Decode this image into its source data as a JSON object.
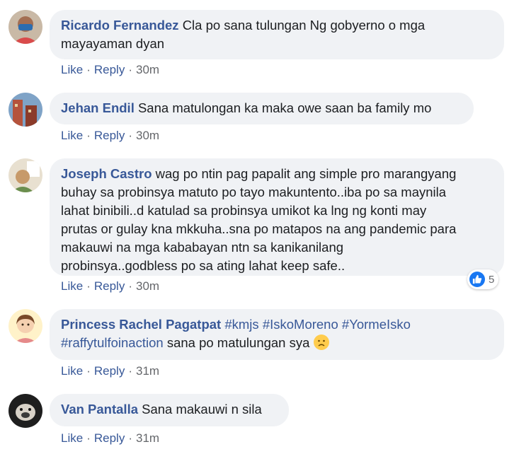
{
  "actions": {
    "like": "Like",
    "reply": "Reply",
    "separator": "·"
  },
  "comments": [
    {
      "author": "Ricardo Fernandez",
      "lines": [
        "Cla po sana tulungan Ng gobyerno o mga",
        "mayayaman dyan"
      ],
      "time": "30m"
    },
    {
      "author": "Jehan Endil",
      "lines": [
        "Sana matulongan ka maka owe saan ba family mo"
      ],
      "time": "30m"
    },
    {
      "author": "Joseph Castro",
      "lines": [
        "wag po ntin pag papalit ang simple pro marangyang",
        "buhay sa probinsya matuto po tayo makuntento..iba po sa maynila",
        "lahat binibili..d katulad sa probinsya umikot ka lng ng konti may",
        "prutas or gulay kna mkkuha..sna po matapos na ang pandemic para",
        "makauwi na mga kababayan ntn sa kanikanilang",
        "probinsya..godbless po sa ating lahat keep safe.."
      ],
      "time": "30m",
      "reaction_count": "5"
    },
    {
      "author": "Princess Rachel Pagatpat",
      "tags": [
        "#kmjs",
        "#IskoMoreno",
        "#YormeIsko",
        "#raffytulfoinaction"
      ],
      "text": "sana po matulungan sya",
      "time": "31m"
    },
    {
      "author": "Van Pantalla",
      "lines": [
        "Sana makauwi n sila"
      ],
      "time": "31m"
    }
  ],
  "colors": {
    "link": "#385898",
    "bubble": "#f0f2f5",
    "meta": "#65676b",
    "like_blue": "#1877f2"
  }
}
